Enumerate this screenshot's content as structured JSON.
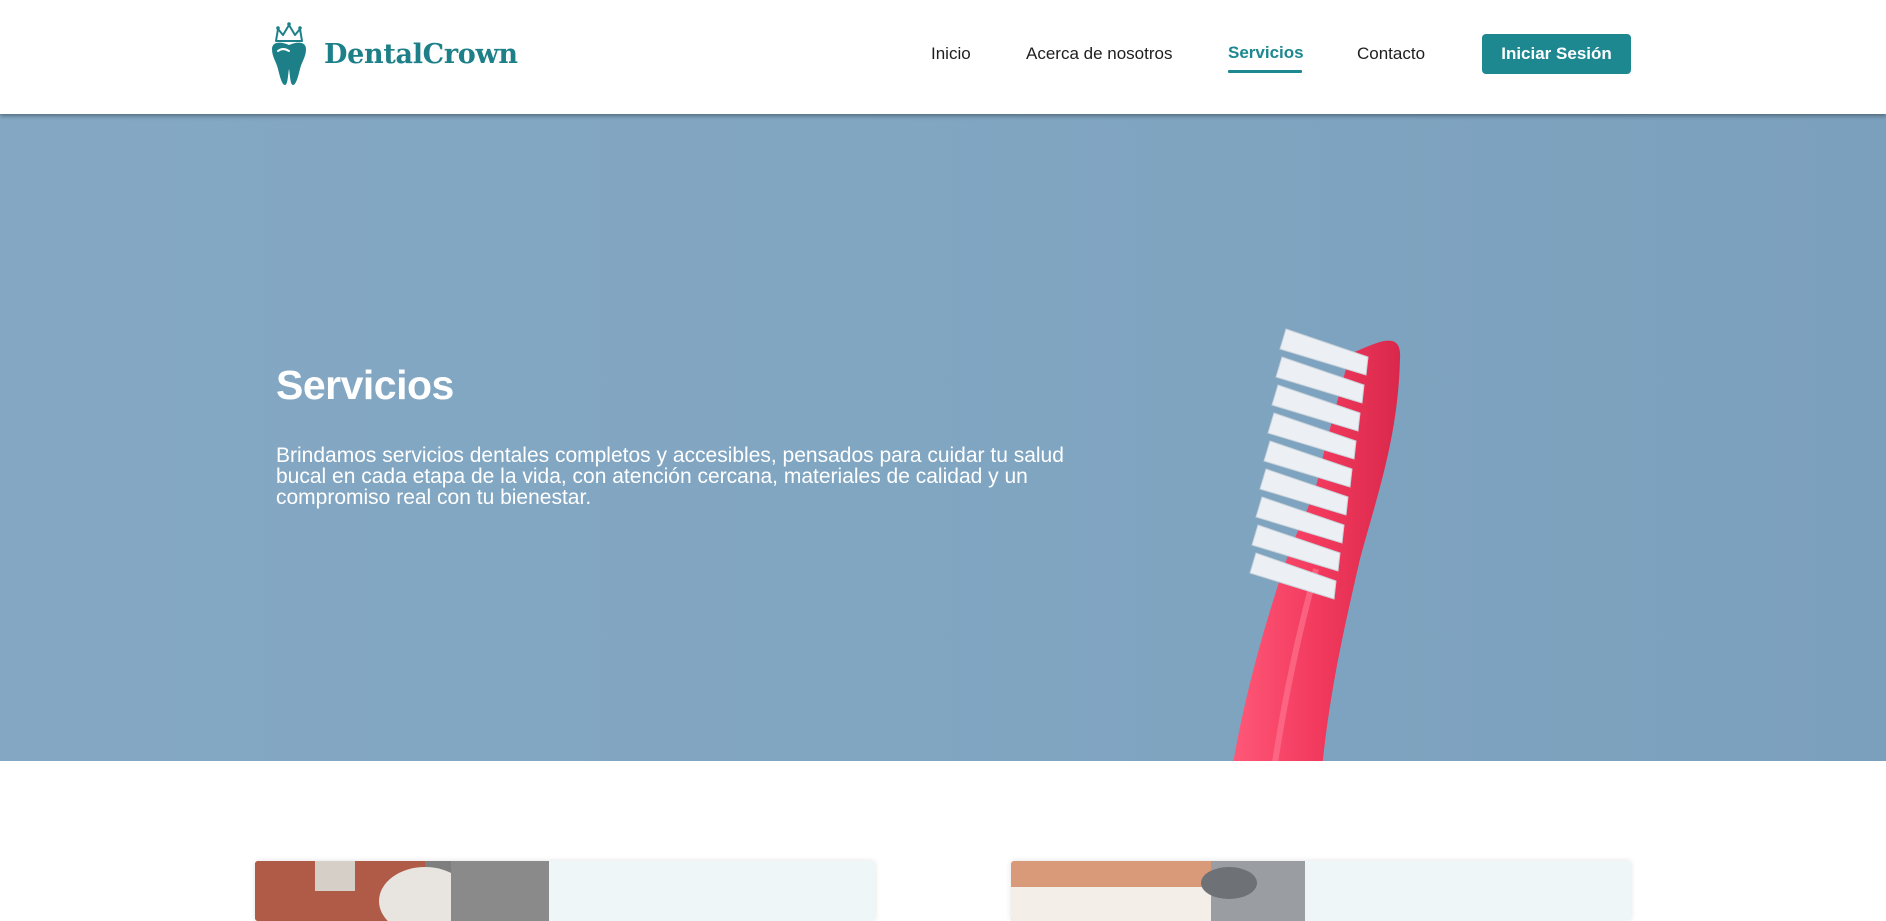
{
  "brand": {
    "name": "DentalCrown",
    "color": "#1d8088",
    "icon": "tooth-crown-icon"
  },
  "nav": {
    "items": [
      {
        "label": "Inicio"
      },
      {
        "label": "Acerca de nosotros"
      },
      {
        "label": "Servicios",
        "active": true
      },
      {
        "label": "Contacto"
      }
    ],
    "login_label": "Iniciar Sesión"
  },
  "hero": {
    "title": "Servicios",
    "description_lines": [
      "Brindamos servicios dentales completos y accesibles, pensados para cuidar tu salud",
      "bucal en cada etapa de la vida, con atención cercana, materiales de calidad y un",
      "compromiso real con tu bienestar."
    ],
    "image": "pink-toothbrush-image"
  },
  "cards": [
    {
      "image": "dental-crown-image"
    },
    {
      "image": "dental-drill-image"
    }
  ],
  "colors": {
    "accent": "#1d8890",
    "hero_bg": "#81a6c2",
    "card_bg": "#eef6f8"
  }
}
